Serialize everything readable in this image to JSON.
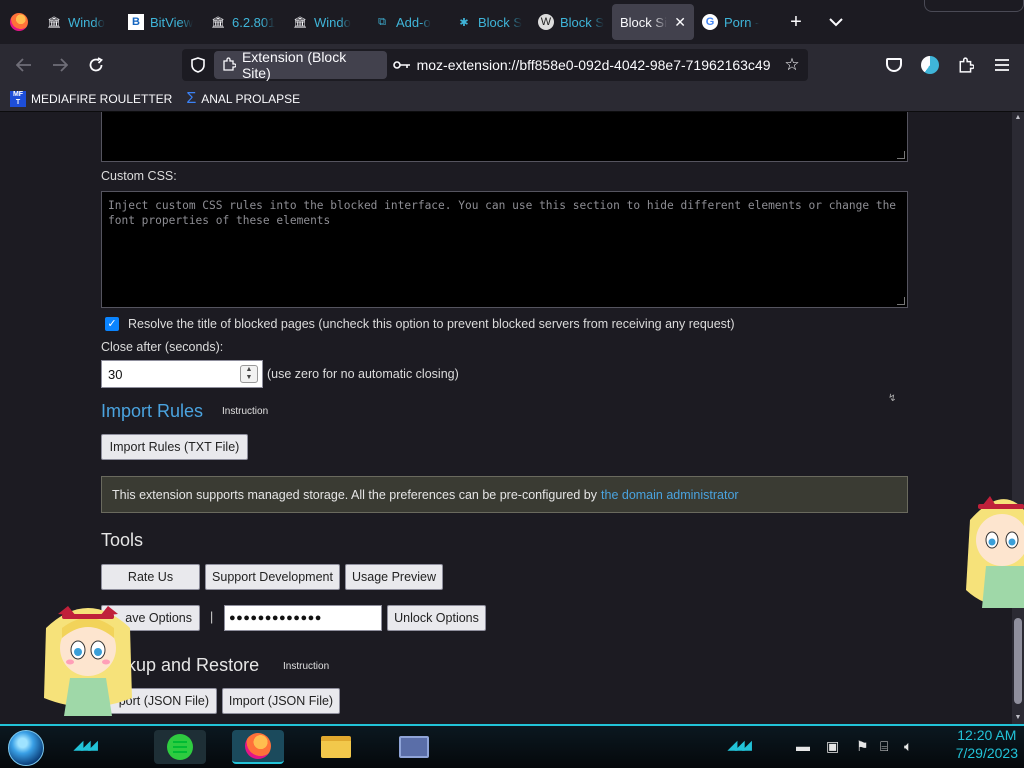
{
  "tabs": [
    {
      "title": "Windo",
      "icon": "museum-icon"
    },
    {
      "title": "BitView",
      "icon": "bitview-icon"
    },
    {
      "title": "6.2.801",
      "icon": "museum-icon"
    },
    {
      "title": "Windo",
      "icon": "museum-icon"
    },
    {
      "title": "Add-o",
      "icon": "puzzle-icon"
    },
    {
      "title": "Block S",
      "icon": "bug-icon"
    },
    {
      "title": "Block S",
      "icon": "wikipedia-icon"
    },
    {
      "title": "Block Si",
      "icon": "none",
      "active": true
    },
    {
      "title": "Porn - ",
      "icon": "google-icon"
    }
  ],
  "urlbar": {
    "identity_label": "Extension (Block Site)",
    "url": "moz-extension://bff858e0-092d-4042-98e7-71962163c49"
  },
  "bookmarks": [
    {
      "label": "MEDIAFIRE ROULETTER",
      "icon": "mediafire-icon"
    },
    {
      "label": "ANAL PROLAPSE",
      "icon": "sigma-icon"
    }
  ],
  "page": {
    "custom_css_label": "Custom CSS:",
    "custom_css_placeholder": "Inject custom CSS rules into the blocked interface. You can use this section to hide different elements or change the font properties of these elements",
    "resolve_title_label": "Resolve the title of blocked pages (uncheck this option to prevent blocked servers from receiving any request)",
    "resolve_title_checked": true,
    "close_after_label": "Close after (seconds):",
    "close_after_value": "30",
    "close_after_hint": "(use zero for no automatic closing)",
    "import_rules_heading": "Import Rules",
    "import_rules_instruction": "Instruction",
    "import_rules_button": "Import Rules (TXT File)",
    "managed_notice": "This extension supports managed storage. All the preferences can be pre-configured by",
    "managed_link": "the domain administrator",
    "tools_heading": "Tools",
    "rate_us": "Rate Us",
    "support_dev": "Support Development",
    "usage_preview": "Usage Preview",
    "save_options": "ave Options",
    "separator": "|",
    "password_mask": "●●●●●●●●●●●●●",
    "unlock_options": "Unlock Options",
    "backup_heading": "ckup and Restore",
    "backup_instruction": "Instruction",
    "export_json": "port (JSON File)",
    "import_json": "Import (JSON File)"
  },
  "taskbar": {
    "time": "12:20 AM",
    "date": "7/29/2023"
  },
  "colors": {
    "accent": "#22c3d8",
    "link": "#4aa3df",
    "tab_text": "#3fb5d9"
  }
}
